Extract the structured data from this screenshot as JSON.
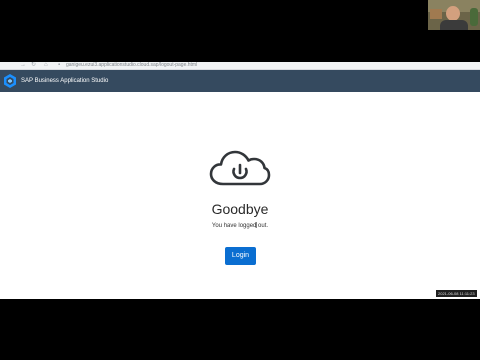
{
  "browser": {
    "url": "ganigeu.ezui3.applicationstudio.cloud.sap/logout-page.html"
  },
  "appbar": {
    "title": "SAP Business Application Studio"
  },
  "logout": {
    "heading": "Goodbye",
    "message": "You have logged out.",
    "login_button": "Login"
  },
  "overlay": {
    "timestamp": "2021-06-08 11:11:23"
  },
  "colors": {
    "appbar_bg": "#354a5f",
    "button_bg": "#0a6ed1",
    "page_bg": "#ffffff",
    "icon_stroke": "#32363a"
  }
}
